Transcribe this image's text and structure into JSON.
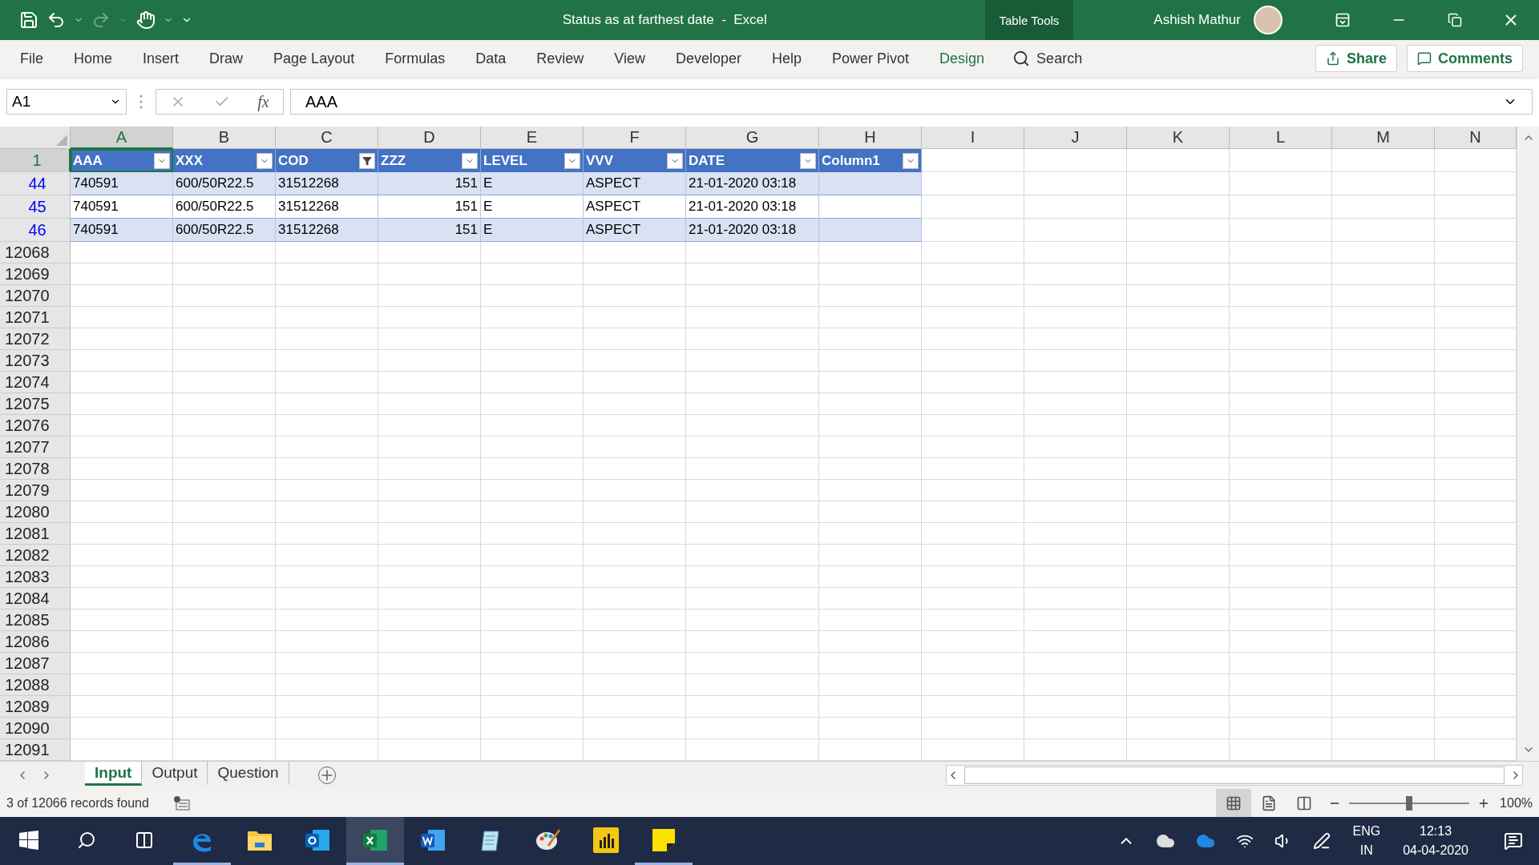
{
  "title_bar": {
    "title": "Status as at farthest date  -  Excel",
    "context_group": "Table Tools",
    "user": "Ashish Mathur"
  },
  "ribbon": {
    "tabs": [
      {
        "label": "File",
        "kind": "normal"
      },
      {
        "label": "Home",
        "kind": "normal"
      },
      {
        "label": "Insert",
        "kind": "normal"
      },
      {
        "label": "Draw",
        "kind": "normal"
      },
      {
        "label": "Page Layout",
        "kind": "normal"
      },
      {
        "label": "Formulas",
        "kind": "normal"
      },
      {
        "label": "Data",
        "kind": "normal"
      },
      {
        "label": "Review",
        "kind": "normal"
      },
      {
        "label": "View",
        "kind": "normal"
      },
      {
        "label": "Developer",
        "kind": "normal"
      },
      {
        "label": "Help",
        "kind": "normal"
      },
      {
        "label": "Power Pivot",
        "kind": "normal"
      },
      {
        "label": "Design",
        "kind": "contextual"
      }
    ],
    "search": "Search",
    "share": "Share",
    "comments": "Comments"
  },
  "formula_bar": {
    "name_box": "A1",
    "function_label": "fx",
    "formula": "AAA"
  },
  "column_headers": [
    {
      "label": "A",
      "selected": true
    },
    {
      "label": "B",
      "selected": false
    },
    {
      "label": "C",
      "selected": false
    },
    {
      "label": "D",
      "selected": false
    },
    {
      "label": "E",
      "selected": false
    },
    {
      "label": "F",
      "selected": false
    },
    {
      "label": "G",
      "selected": false
    },
    {
      "label": "H",
      "selected": false
    },
    {
      "label": "I",
      "selected": false
    },
    {
      "label": "J",
      "selected": false
    },
    {
      "label": "K",
      "selected": false
    },
    {
      "label": "L",
      "selected": false
    },
    {
      "label": "M",
      "selected": false
    },
    {
      "label": "N",
      "selected": false
    }
  ],
  "table": {
    "header_row": {
      "row_number": "1",
      "selected": true
    },
    "columns": [
      {
        "label": "AAA",
        "kind": "text",
        "filtered": false
      },
      {
        "label": "XXX",
        "kind": "text",
        "filtered": false
      },
      {
        "label": "COD",
        "kind": "text",
        "filtered": true
      },
      {
        "label": "ZZZ",
        "kind": "number",
        "filtered": false
      },
      {
        "label": "LEVEL",
        "kind": "text",
        "filtered": false
      },
      {
        "label": "VVV",
        "kind": "text",
        "filtered": false
      },
      {
        "label": "DATE",
        "kind": "text",
        "filtered": false
      },
      {
        "label": "Column1",
        "filtered": false
      }
    ],
    "rows": [
      {
        "row_number": "44",
        "cells": [
          "740591",
          "600/50R22.5",
          "31512268",
          "151",
          "E",
          "ASPECT",
          "21-01-2020 03:18"
        ]
      },
      {
        "row_number": "45",
        "cells": [
          "740591",
          "600/50R22.5",
          "31512268",
          "151",
          "E",
          "ASPECT",
          "21-01-2020 03:18"
        ]
      },
      {
        "row_number": "46",
        "cells": [
          "740591",
          "600/50R22.5",
          "31512268",
          "151",
          "E",
          "ASPECT",
          "21-01-2020 03:18"
        ]
      }
    ]
  },
  "empty_rows": [
    "12068",
    "12069",
    "12070",
    "12071",
    "12072",
    "12073",
    "12074",
    "12075",
    "12076",
    "12077",
    "12078",
    "12079",
    "12080",
    "12081",
    "12082",
    "12083",
    "12084",
    "12085",
    "12086",
    "12087",
    "12088",
    "12089",
    "12090",
    "12091"
  ],
  "sheet_tabs": [
    {
      "label": "Input",
      "selected": true
    },
    {
      "label": "Output",
      "selected": false
    },
    {
      "label": "Question",
      "selected": false
    }
  ],
  "status_bar": {
    "message": "3 of 12066 records found",
    "views": [
      {
        "kind": "normal",
        "selected": true
      },
      {
        "kind": "page-layout",
        "selected": false
      },
      {
        "kind": "page-break",
        "selected": false
      }
    ],
    "zoom": {
      "level": 0.5,
      "reading": "100%"
    }
  },
  "taskbar": {
    "apps": [
      {
        "kind": "edge",
        "running": true,
        "selected": false
      },
      {
        "kind": "folder",
        "running": false,
        "selected": false
      },
      {
        "kind": "outlook",
        "running": false,
        "selected": false
      },
      {
        "kind": "excel",
        "running": true,
        "selected": true
      },
      {
        "kind": "word",
        "running": false,
        "selected": false
      },
      {
        "kind": "notepad",
        "running": false,
        "selected": false
      },
      {
        "kind": "paint",
        "running": false,
        "selected": false
      },
      {
        "kind": "powerbi",
        "running": false,
        "selected": false
      },
      {
        "kind": "sticky",
        "running": true,
        "selected": false
      }
    ],
    "tray": {
      "language": "ENG",
      "region": "IN",
      "time": "12:13",
      "date": "04-04-2020"
    }
  }
}
